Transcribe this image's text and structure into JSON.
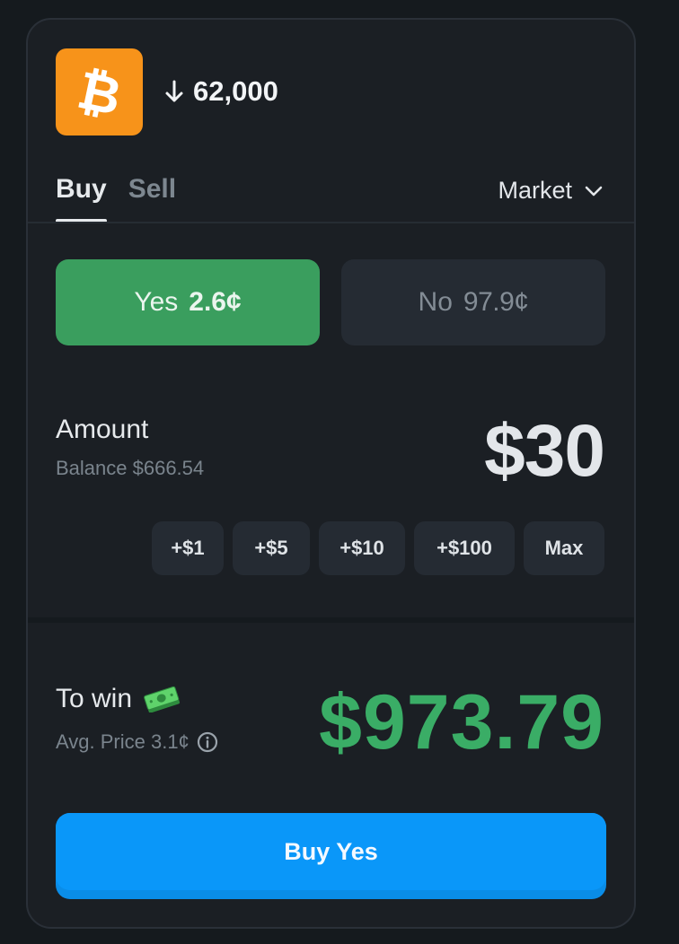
{
  "market": {
    "asset_icon": "bitcoin-logo",
    "direction_icon": "arrow-down-icon",
    "target": "62,000"
  },
  "tabs": [
    {
      "label": "Buy",
      "active": true
    },
    {
      "label": "Sell",
      "active": false
    }
  ],
  "order_type": {
    "label": "Market",
    "icon": "chevron-down-icon"
  },
  "outcomes": {
    "yes": {
      "label": "Yes",
      "price": "2.6¢",
      "selected": true
    },
    "no": {
      "label": "No",
      "price": "97.9¢",
      "selected": false
    }
  },
  "amount": {
    "label": "Amount",
    "balance": "Balance $666.54",
    "value": "$30",
    "quick_buttons": [
      "+$1",
      "+$5",
      "+$10",
      "+$100",
      "Max"
    ]
  },
  "to_win": {
    "label": "To win",
    "icon": "money-icon",
    "avg_price": "Avg. Price 3.1¢",
    "info_icon": "info-icon",
    "value": "$973.79"
  },
  "action": {
    "label": "Buy Yes"
  },
  "colors": {
    "yes": "#3a9e5e",
    "win": "#3aad66",
    "primary": "#0a97f9",
    "bitcoin": "#f7931a"
  }
}
